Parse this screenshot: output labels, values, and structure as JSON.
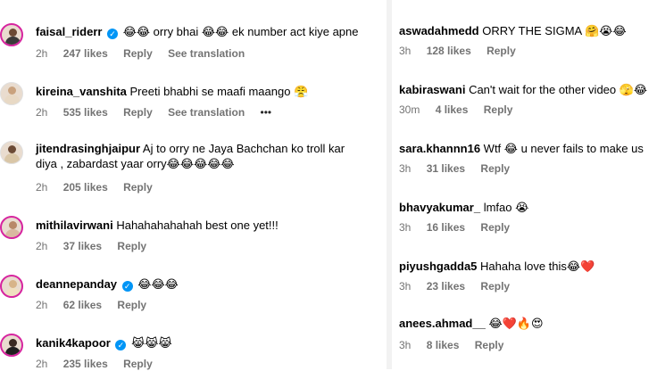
{
  "left": [
    {
      "user": "faisal_riderr",
      "verified": true,
      "text": "😂😂 orry bhai 😂😂 ek number act kiye apne",
      "time": "2h",
      "likes": "247 likes",
      "reply": "Reply",
      "translate": "See translation",
      "more": ""
    },
    {
      "user": "kireina_vanshita",
      "verified": false,
      "text": "Preeti bhabhi se maafi maango 😤",
      "time": "2h",
      "likes": "535 likes",
      "reply": "Reply",
      "translate": "See translation",
      "more": "•••"
    },
    {
      "user": "jitendrasinghjaipur",
      "verified": false,
      "text": "Aj to orry ne Jaya Bachchan ko troll kar diya , zabardast yaar orry😂😂😂😂😂",
      "time": "2h",
      "likes": "205 likes",
      "reply": "Reply",
      "translate": "",
      "more": ""
    },
    {
      "user": "mithilavirwani",
      "verified": false,
      "text": "Hahahahahahah best one yet!!!",
      "time": "2h",
      "likes": "37 likes",
      "reply": "Reply",
      "translate": "",
      "more": ""
    },
    {
      "user": "deannepanday",
      "verified": true,
      "text": "😂😂😂",
      "time": "2h",
      "likes": "62 likes",
      "reply": "Reply",
      "translate": "",
      "more": ""
    },
    {
      "user": "kanik4kapoor",
      "verified": true,
      "text": "😹😹😹",
      "time": "2h",
      "likes": "235 likes",
      "reply": "Reply",
      "translate": "",
      "more": ""
    }
  ],
  "right": [
    {
      "user": "aswadahmedd",
      "text": "ORRY THE SIGMA 🤗😭😂",
      "time": "3h",
      "likes": "128 likes",
      "reply": "Reply"
    },
    {
      "user": "kabiraswani",
      "text": "Can't wait for the other video 🫣😂",
      "time": "30m",
      "likes": "4 likes",
      "reply": "Reply"
    },
    {
      "user": "sara.khannn16",
      "text": "Wtf 😂 u never fails to make us",
      "time": "3h",
      "likes": "31 likes",
      "reply": "Reply"
    },
    {
      "user": "bhavyakumar_",
      "text": "lmfao 😭",
      "time": "3h",
      "likes": "16 likes",
      "reply": "Reply"
    },
    {
      "user": "piyushgadda5",
      "text": "Hahaha love this😂❤️",
      "time": "3h",
      "likes": "23 likes",
      "reply": "Reply"
    },
    {
      "user": "anees.ahmad__",
      "text": "😂❤️🔥😍",
      "time": "3h",
      "likes": "8 likes",
      "reply": "Reply"
    }
  ],
  "colors": {
    "verified": "#0095f6",
    "meta": "#737373",
    "story_ring": "#d6249f"
  }
}
